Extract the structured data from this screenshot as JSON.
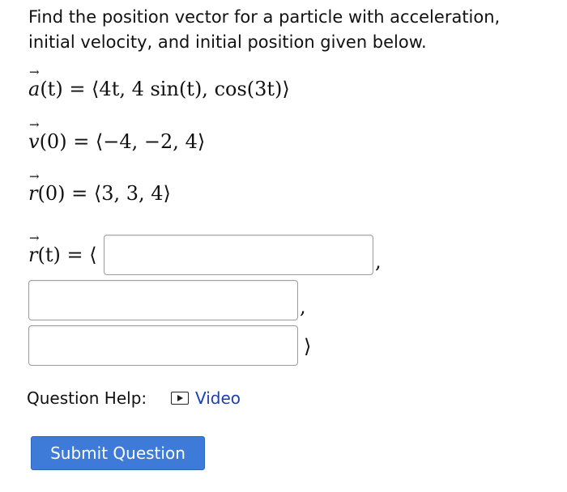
{
  "prompt": {
    "line1": "Find the position vector for a particle with acceleration,",
    "line2": "initial velocity, and initial position given below."
  },
  "equations": {
    "acceleration": {
      "var": "a",
      "arg": "(t)",
      "rhs": " = ⟨4t, 4 sin(t), cos(3t)⟩"
    },
    "velocity": {
      "var": "v",
      "arg": "(0)",
      "rhs": " = ⟨−4, −2, 4⟩"
    },
    "position": {
      "var": "r",
      "arg": "(0)",
      "rhs": " = ⟨3, 3, 4⟩"
    },
    "answer": {
      "var": "r",
      "arg": "(t)",
      "rhs": " = ⟨"
    }
  },
  "answer_inputs": {
    "component1_value": "",
    "component2_value": "",
    "component3_value": "",
    "separator1": ",",
    "separator2": ",",
    "closing_bracket": "⟩"
  },
  "help": {
    "label": "Question Help:",
    "video_label": "Video"
  },
  "submit": {
    "label": "Submit Question",
    "color": "#3e7bd9"
  },
  "colors": {
    "link": "#1f3fae",
    "input_border": "#9c9c9c"
  },
  "icons": {
    "vector_arrow": "→",
    "video": "play-box-icon"
  }
}
